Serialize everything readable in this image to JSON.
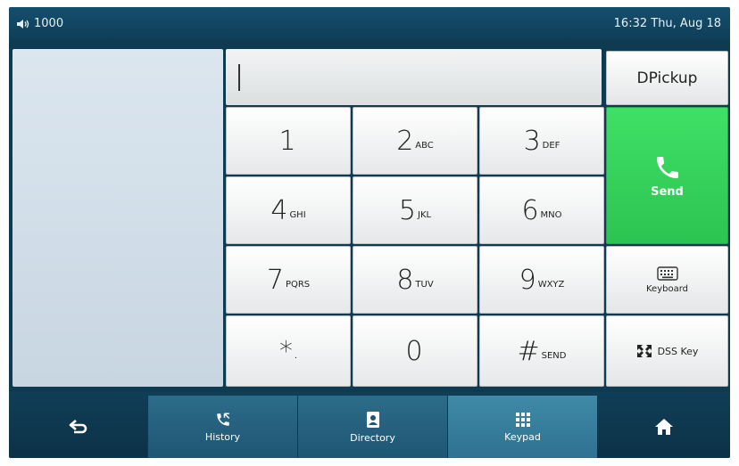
{
  "status_bar": {
    "account": "1000",
    "datetime": "16:32 Thu, Aug 18",
    "speaker_icon": "speaker-icon"
  },
  "dial_input": {
    "value": ""
  },
  "keypad": {
    "keys": [
      {
        "digit": "1",
        "letters": ""
      },
      {
        "digit": "2",
        "letters": "ABC"
      },
      {
        "digit": "3",
        "letters": "DEF"
      },
      {
        "digit": "4",
        "letters": "GHI"
      },
      {
        "digit": "5",
        "letters": "JKL"
      },
      {
        "digit": "6",
        "letters": "MNO"
      },
      {
        "digit": "7",
        "letters": "PQRS"
      },
      {
        "digit": "8",
        "letters": "TUV"
      },
      {
        "digit": "9",
        "letters": "WXYZ"
      },
      {
        "digit": "*",
        "letters": "."
      },
      {
        "digit": "0",
        "letters": ""
      },
      {
        "digit": "#",
        "letters": "SEND"
      }
    ]
  },
  "side_buttons": {
    "dpickup": "DPickup",
    "send": "Send",
    "keyboard": "Keyboard",
    "dss_key": "DSS Key"
  },
  "bottom_nav": {
    "back_icon": "back-arrow-icon",
    "history": "History",
    "directory": "Directory",
    "keypad": "Keypad",
    "home_icon": "home-icon"
  },
  "colors": {
    "send_green": "#35d35a",
    "nav_active": "#3f8aa8",
    "status_bar": "#144f6e"
  }
}
